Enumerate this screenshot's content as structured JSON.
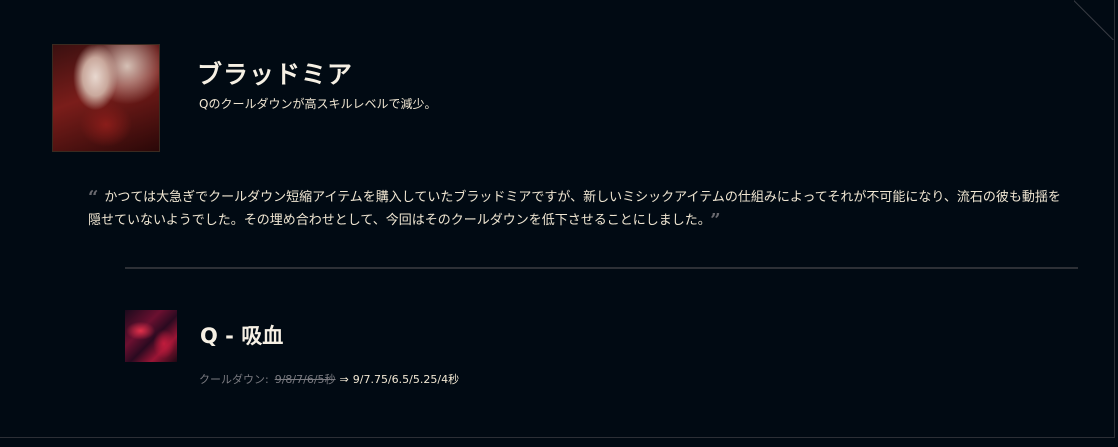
{
  "champion": {
    "name": "ブラッドミア",
    "summary": "Qのクールダウンが高スキルレベルで減少。"
  },
  "quote": {
    "open_mark": "“",
    "text": "かつては大急ぎでクールダウン短縮アイテムを購入していたブラッドミアですが、新しいミシックアイテムの仕組みによってそれが不可能になり、流石の彼も動揺を隠せていないようでした。その埋め合わせとして、今回はそのクールダウンを低下させることにしました。",
    "close_mark": "”"
  },
  "ability": {
    "name": "Q - 吸血",
    "attribute_label": "クールダウン:",
    "old_value": "9/8/7/6/5秒",
    "arrow": "⇒",
    "new_value": "9/7.75/6.5/5.25/4秒"
  },
  "icons": {
    "champion_portrait": "vladimir-portrait",
    "ability_icon": "transfusion-icon"
  },
  "colors": {
    "background": "#010a13",
    "text": "#f0e6d2",
    "muted": "#7c7c82",
    "divider": "#2d3036"
  }
}
